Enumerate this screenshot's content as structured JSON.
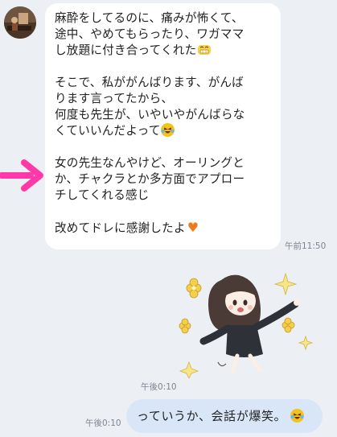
{
  "colors": {
    "background": "#eceff4",
    "incoming_bubble": "#ffffff",
    "outgoing_bubble": "#d9e6f8",
    "timestamp": "#7d8591",
    "arrow": "#ff3aa8"
  },
  "incoming_message": {
    "paragraph_1": "麻酔をしてるのに、痛みが怖くて、\n途中、やめてもらったり、ワガママ\nし放題に付き合ってくれた",
    "paragraph_2": "そこで、私ががんばります、がんば\nります言ってたから、\n何度も先生が、いやいやがんばらな\nくていいんだよって",
    "paragraph_3": "女の先生なんやけど、オーリングと\nか、チャクラとか多方面でアプロー\nチしてくれる感じ",
    "paragraph_4": "改めてドレに感謝したよ",
    "paragraph_1_emoji": "grinning-emoji",
    "paragraph_2_emoji": "laughing-crying-emoji",
    "paragraph_4_emoji": "orange-heart-emoji",
    "time": "午前11:50"
  },
  "annotation": {
    "icon": "pink-arrow"
  },
  "sticker": {
    "description_icon": "girl-dancing-sticker",
    "time": "午後0:10"
  },
  "outgoing_message": {
    "text": "っていうか、会話が爆笑。",
    "emoji": "laughing-crying-emoji",
    "time": "午後0:10"
  }
}
